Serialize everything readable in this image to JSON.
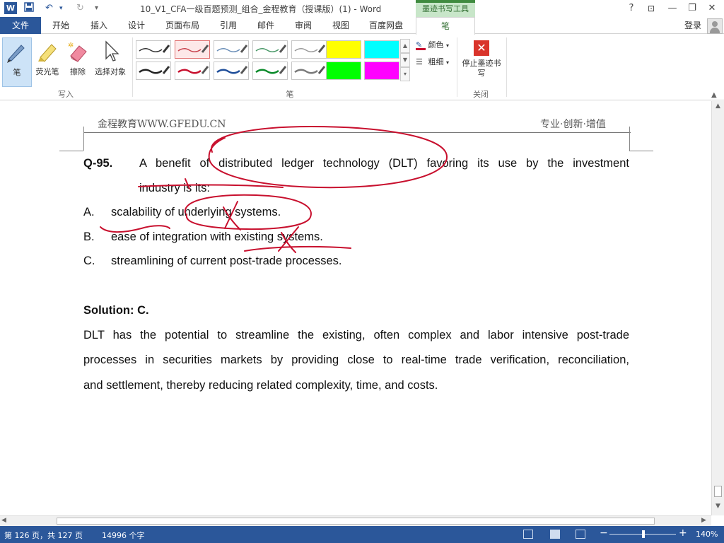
{
  "titlebar": {
    "title": "10_V1_CFA一级百题预测_组合_金程教育（授课版）(1) - Word",
    "context_tab_group": "墨迹书写工具",
    "help": "?",
    "minimize": "—",
    "restore": "❐",
    "close": "✕",
    "ribbon_options": "⊡"
  },
  "tabs": {
    "file": "文件",
    "items": [
      "开始",
      "插入",
      "设计",
      "页面布局",
      "引用",
      "邮件",
      "审阅",
      "视图",
      "百度网盘"
    ],
    "active": "笔",
    "signin": "登录"
  },
  "ribbon": {
    "write_group": {
      "label": "写入",
      "tools": [
        "笔",
        "荧光笔",
        "擦除",
        "选择对象"
      ]
    },
    "pens_group": {
      "label": "笔",
      "color": "颜色",
      "weight": "粗细",
      "swatches_top": [
        "#333333",
        "#c8424d",
        "#6b8fb8",
        "#4c9a6a",
        "#9a9a9a",
        "#ffff00",
        "#00ffff"
      ],
      "swatches_bottom": [
        "#222222",
        "#c8102e",
        "#1f4e9a",
        "#0a8a2a",
        "#7a7a7a",
        "#00ff00",
        "#ff00ff"
      ]
    },
    "close_group": {
      "label": "关闭",
      "stop": "停止墨迹书写"
    }
  },
  "document": {
    "header_left": "金程教育WWW.GFEDU.CN",
    "header_right": "专业·创新·增值",
    "question_number": "Q-95.",
    "question_line1": "A benefit of distributed ledger technology (DLT) favoring its use by the investment",
    "question_line2": "industry is its:",
    "options": [
      {
        "letter": "A.",
        "text": "scalability of underlying systems."
      },
      {
        "letter": "B.",
        "text": "ease of integration with existing systems."
      },
      {
        "letter": "C.",
        "text": "streamlining of current post-trade processes."
      }
    ],
    "solution_label": "Solution: C.",
    "solution_lines": [
      "DLT has the potential to streamline the existing, often complex and labor intensive post-trade",
      "processes in securities markets by providing close to real-time trade verification, reconciliation,",
      "and settlement, thereby reducing related complexity, time, and costs."
    ],
    "ink_color": "#c8102e"
  },
  "statusbar": {
    "page": "第 126 页，共 127 页",
    "words": "14996 个字",
    "zoom": "140%",
    "zoom_minus": "−",
    "zoom_plus": "+"
  },
  "colors": {
    "word_blue": "#2b579a",
    "ink_green_tab": "#c8e6c9"
  }
}
